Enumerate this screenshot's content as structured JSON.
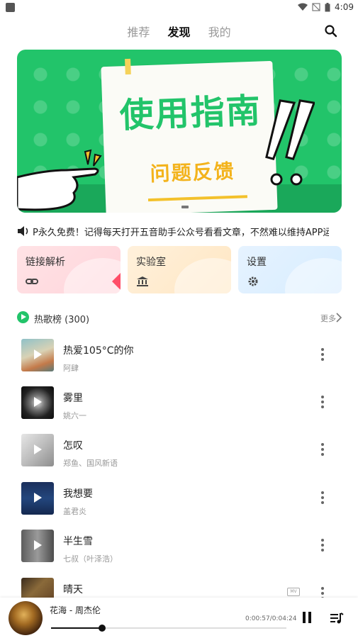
{
  "status_bar": {
    "time": "4:09"
  },
  "top_nav": {
    "tabs": [
      {
        "label": "推荐",
        "active": false
      },
      {
        "label": "发现",
        "active": true
      },
      {
        "label": "我的",
        "active": false
      }
    ],
    "search_icon": "search-icon"
  },
  "banner": {
    "title": "使用指南",
    "subtitle": "问题反馈",
    "accent_color": "#22c46a"
  },
  "notice": {
    "icon": "speaker-icon",
    "text": "P永久免费！记得每天打开五音助手公众号看看文章，不然难以维持APP运营啊"
  },
  "feature_cards": [
    {
      "label": "链接解析",
      "icon": "link-icon"
    },
    {
      "label": "实验室",
      "icon": "bank-icon"
    },
    {
      "label": "设置",
      "icon": "gear-icon"
    }
  ],
  "hot_chart": {
    "title": "热歌榜 (300)",
    "more_label": "更多"
  },
  "songs": [
    {
      "name": "热爱105°C的你",
      "artist": "阿肆",
      "has_mv": false
    },
    {
      "name": "雾里",
      "artist": "姚六一",
      "has_mv": false
    },
    {
      "name": "怎叹",
      "artist": "郑鱼、国风新语",
      "has_mv": false
    },
    {
      "name": "我想要",
      "artist": "盖君炎",
      "has_mv": false
    },
    {
      "name": "半生雪",
      "artist": "七叔（叶泽浩）",
      "has_mv": false
    },
    {
      "name": "晴天",
      "artist": "",
      "has_mv": true
    }
  ],
  "mv_label": "MV",
  "player": {
    "title": "花海 - 周杰伦",
    "time": "0:00:57/0:04:24",
    "progress": 0.216
  }
}
